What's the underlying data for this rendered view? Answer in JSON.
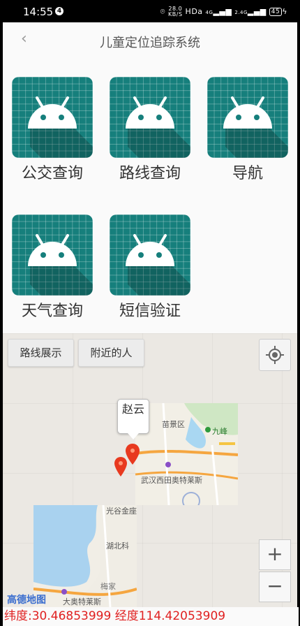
{
  "status_bar": {
    "time": "14:55",
    "notification_badge": "4",
    "net_speed_value": "28.0",
    "net_speed_unit": "KB/S",
    "hd_label": "HD",
    "hd_sub": "a",
    "signal_1": "4G",
    "signal_2": "2.4G",
    "battery": "45"
  },
  "header": {
    "title": "儿童定位追踪系统"
  },
  "tiles": [
    {
      "label": "公交查询",
      "icon": "android-robot-icon"
    },
    {
      "label": "路线查询",
      "icon": "android-robot-icon"
    },
    {
      "label": "导航",
      "icon": "android-robot-icon"
    },
    {
      "label": "天气查询",
      "icon": "android-robot-icon"
    },
    {
      "label": "短信验证",
      "icon": "android-robot-icon"
    }
  ],
  "map": {
    "btn_route": "路线展示",
    "btn_nearby": "附近的人",
    "callout_name": "赵云",
    "place_a": "苗景区",
    "place_b": "九峰",
    "place_c": "武汉西田奥特莱斯",
    "place_d": "光谷金座",
    "place_e": "湖北科",
    "place_f": "梅家",
    "place_g": "大奥特莱斯",
    "zoom_in": "+",
    "zoom_out": "−",
    "brand": "高德地图"
  },
  "coords_text": "纬度:30.46853999 经度114.42053909",
  "colors": {
    "tile": "#167f7c",
    "coords": "#e02020"
  }
}
